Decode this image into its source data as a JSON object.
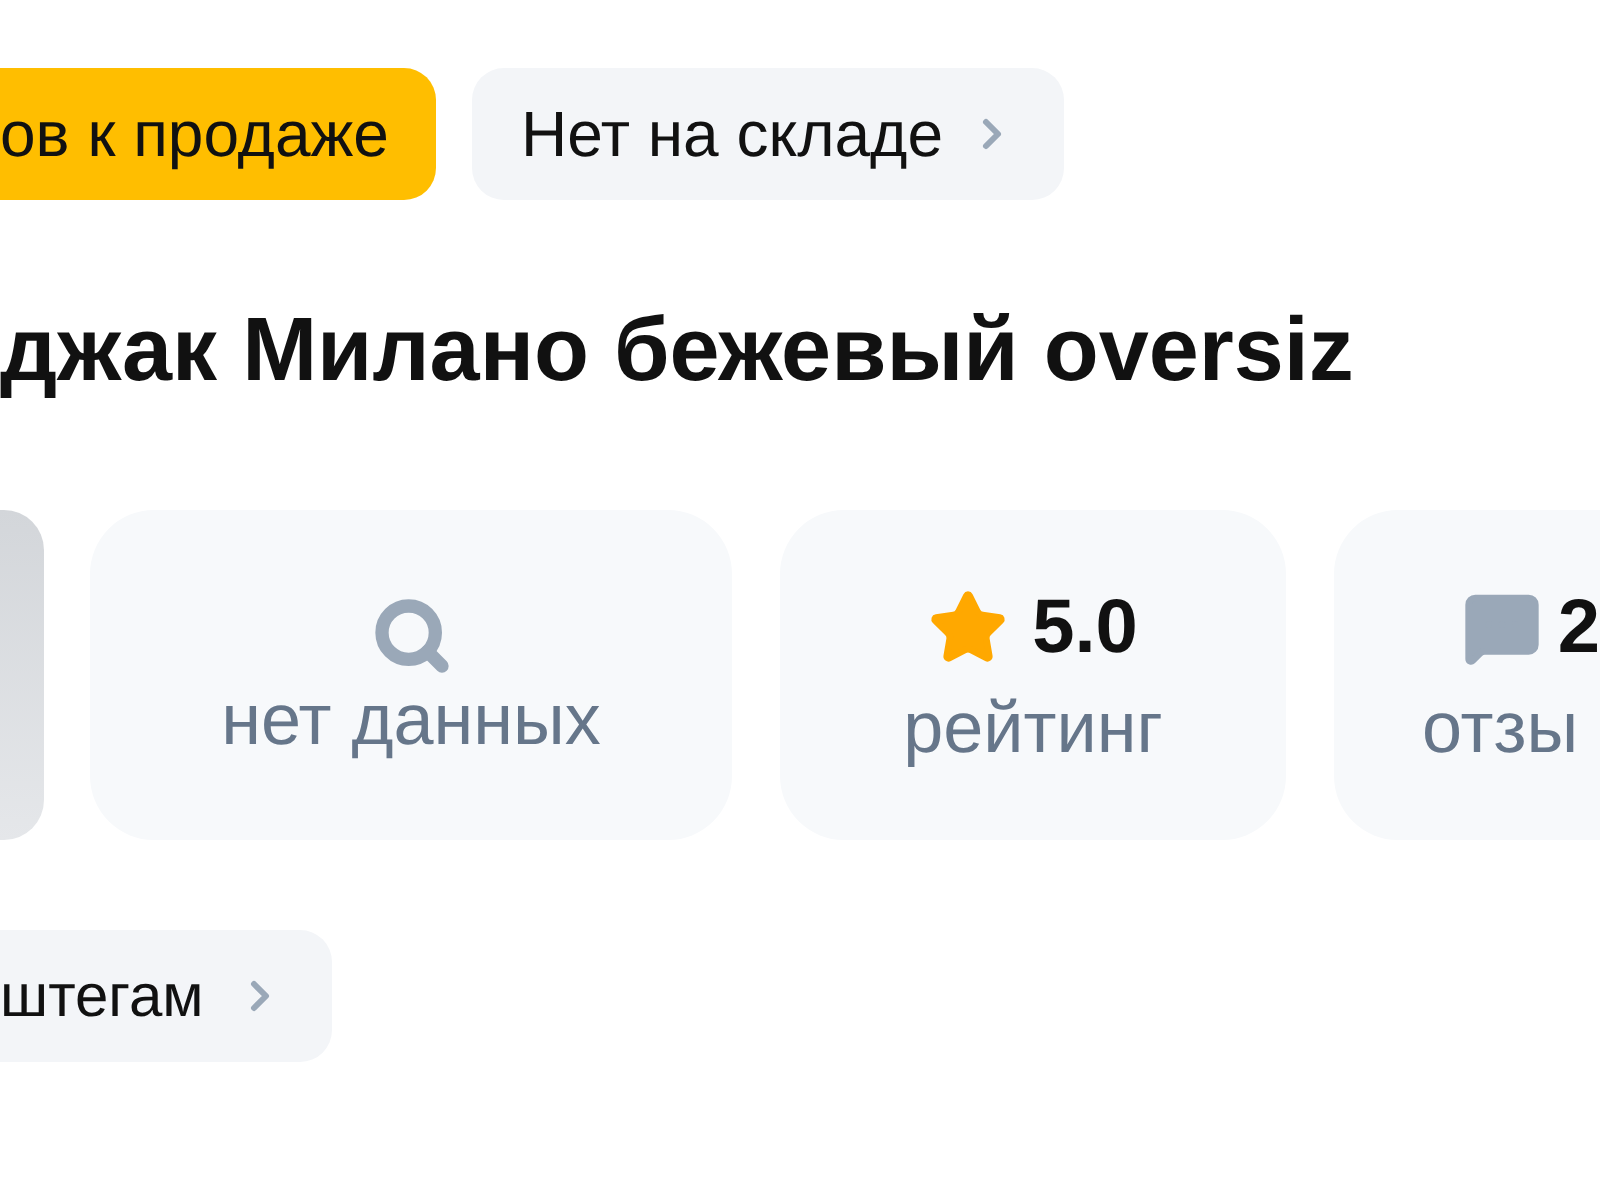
{
  "chips": [
    {
      "label": "ов к продаже",
      "kind": "highlight"
    },
    {
      "label": "Нет на складе",
      "kind": "link"
    }
  ],
  "title": "джак Милано бежевый oversiz",
  "stats": [
    {
      "kind": "image"
    },
    {
      "kind": "search",
      "label": "нет данных"
    },
    {
      "kind": "rating",
      "value": "5.0",
      "label": "рейтинг"
    },
    {
      "kind": "reviews",
      "value": "2",
      "label": "отзы"
    }
  ],
  "hashtags": {
    "label": "штегам"
  }
}
